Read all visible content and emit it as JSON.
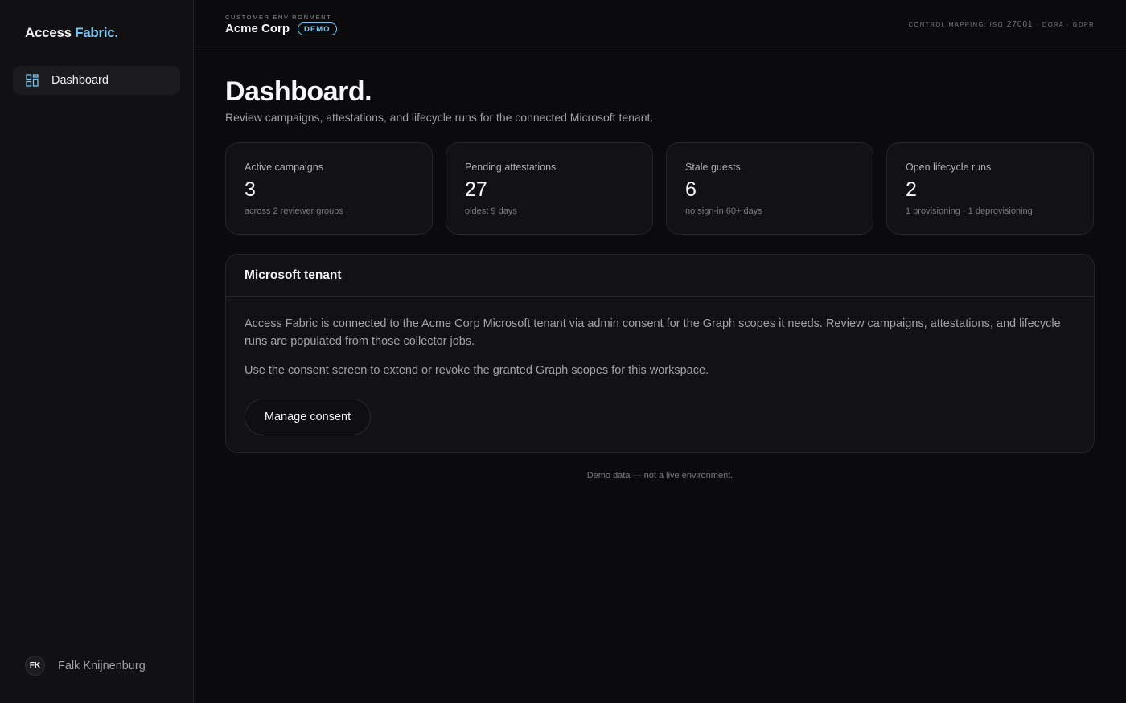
{
  "brand": {
    "name": "Access",
    "accent": "Fabric."
  },
  "sidebar": {
    "items": [
      {
        "label": "Dashboard",
        "icon": "dashboard-grid-icon",
        "active": true
      }
    ],
    "user": {
      "initials": "FK",
      "name": "Falk Knijnenburg"
    }
  },
  "header": {
    "env_label": "CUSTOMER ENVIRONMENT",
    "env_name": "Acme Corp",
    "badge": "DEMO",
    "control_prefix": "CONTROL MAPPING: ISO",
    "control_iso": "27001",
    "control_suffix": "· DORA · GDPR"
  },
  "page": {
    "title": "Dashboard.",
    "subtitle": "Review campaigns, attestations, and lifecycle runs for the connected Microsoft tenant."
  },
  "stats": [
    {
      "label": "Active campaigns",
      "value": "3",
      "note": "across 2 reviewer groups"
    },
    {
      "label": "Pending attestations",
      "value": "27",
      "note": "oldest 9 days"
    },
    {
      "label": "Stale guests",
      "value": "6",
      "note": "no sign-in 60+ days"
    },
    {
      "label": "Open lifecycle runs",
      "value": "2",
      "note": "1 provisioning · 1 deprovisioning"
    }
  ],
  "tenant_panel": {
    "title": "Microsoft tenant",
    "p1": "Access Fabric is connected to the Acme Corp Microsoft tenant via admin consent for the Graph scopes it needs. Review campaigns, attestations, and lifecycle runs are populated from those collector jobs.",
    "p2": "Use the consent screen to extend or revoke the granted Graph scopes for this workspace.",
    "button": "Manage consent"
  },
  "footer": "Demo data — not a live environment.",
  "colors": {
    "accent": "#7cc4ee",
    "background": "#0b0b0d",
    "sidebar": "#111113"
  }
}
